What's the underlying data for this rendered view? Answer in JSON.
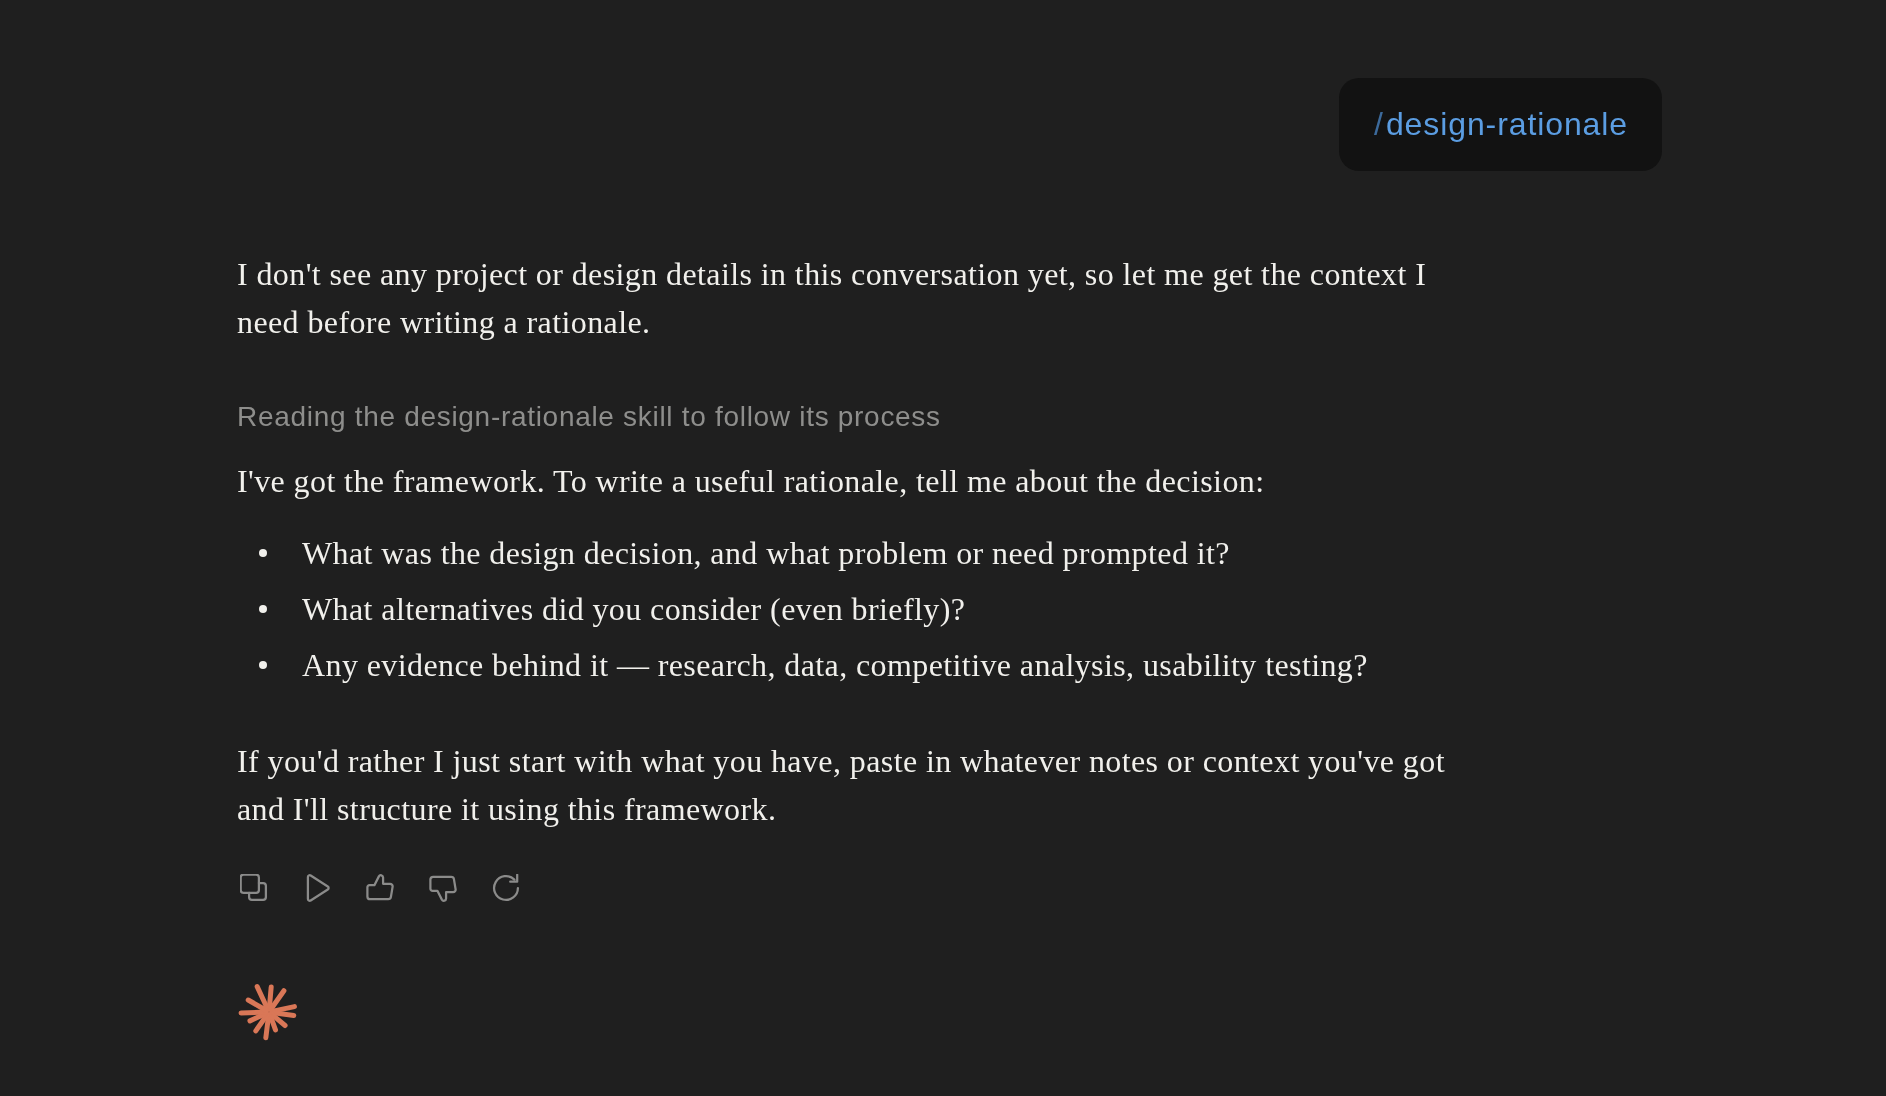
{
  "user_message": {
    "prefix": "/",
    "command": "design-rationale"
  },
  "reply": {
    "intro": "I don't see any project or design details in this conversation yet, so let me get the context I need before writing a rationale.",
    "tool_status": "Reading the design-rationale skill to follow its process",
    "lead": "I've got the framework. To write a useful rationale, tell me about the decision:",
    "questions": [
      "What was the design decision, and what problem or need prompted it?",
      "What alternatives did you consider (even briefly)?",
      "Any evidence behind it — research, data, competitive analysis, usability testing?"
    ],
    "closing": "If you'd rather I just start with what you have, paste in whatever notes or context you've got and I'll structure it using this framework."
  }
}
